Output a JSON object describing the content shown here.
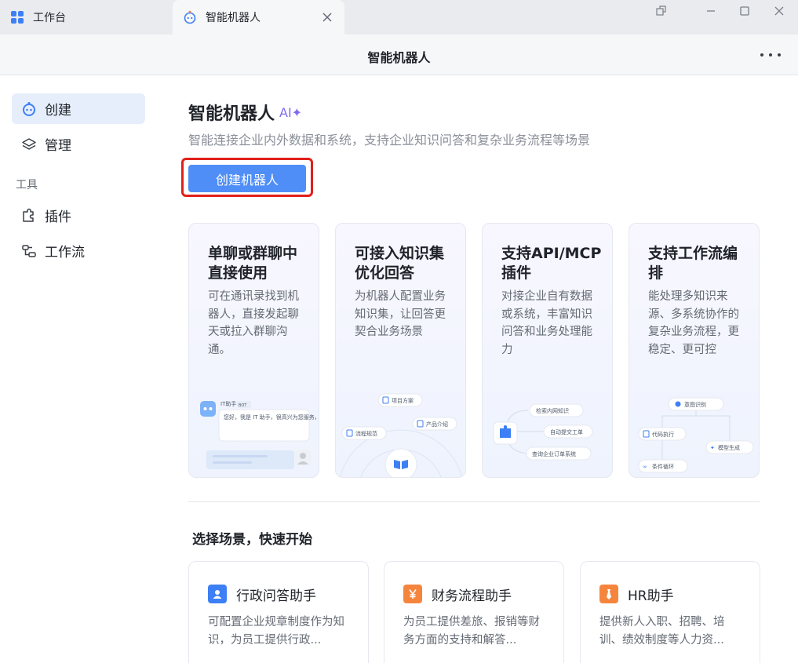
{
  "tabs": [
    {
      "label": "工作台",
      "icon": "grid-icon"
    },
    {
      "label": "智能机器人",
      "icon": "robot-icon"
    }
  ],
  "header": {
    "title": "智能机器人"
  },
  "sidebar": {
    "items": [
      {
        "label": "创建",
        "icon": "robot-icon",
        "active": true
      },
      {
        "label": "管理",
        "icon": "layers-icon"
      }
    ],
    "section_label": "工具",
    "tool_items": [
      {
        "label": "插件",
        "icon": "plugin-icon"
      },
      {
        "label": "工作流",
        "icon": "workflow-icon"
      }
    ]
  },
  "hero": {
    "title": "智能机器人",
    "badge": "AI✦",
    "subtitle": "智能连接企业内外数据和系统，支持企业知识问答和复杂业务流程等场景",
    "create_button": "创建机器人"
  },
  "features": [
    {
      "title": "单聊或群聊中直接使用",
      "desc": "可在通讯录找到机器人，直接发起聊天或拉入群聊沟通。",
      "illu": {
        "bot_name": "IT助手",
        "bot_tag": "BOT",
        "message": "您好，我是 IT 助手，很高兴为您服务，请描述您的问题。"
      }
    },
    {
      "title": "可接入知识集优化回答",
      "desc": "为机器人配置业务知识集，让回答更契合业务场景",
      "illu": {
        "chip1": "项目方案",
        "chip2": "产品介绍",
        "chip3": "流程规范"
      }
    },
    {
      "title": "支持API/MCP插件",
      "desc": "对接企业自有数据或系统，丰富知识问答和业务处理能力",
      "illu": {
        "chip1": "检索内网知识",
        "chip2": "自动提交工单",
        "chip3": "查询企业订单系统"
      }
    },
    {
      "title": "支持工作流编排",
      "desc": "能处理多知识来源、多系统协作的复杂业务流程，更稳定、更可控",
      "illu": {
        "chip1": "意图识别",
        "chip2": "代码执行",
        "chip3": "模型生成",
        "chip4": "条件循环"
      }
    }
  ],
  "scenes_title": "选择场景，快速开始",
  "scenes": [
    {
      "title": "行政问答助手",
      "desc": "可配置企业规章制度作为知识，为员工提供行政...",
      "icon": "person-card-icon",
      "color": "#3d7ff5"
    },
    {
      "title": "财务流程助手",
      "desc": "为员工提供差旅、报销等财务方面的支持和解答...",
      "icon": "yen-icon",
      "color": "#f5853d"
    },
    {
      "title": "HR助手",
      "desc": "提供新人入职、招聘、培训、绩效制度等人力资...",
      "icon": "tie-icon",
      "color": "#f5853d"
    }
  ],
  "colors": {
    "accent": "#4f8ef7",
    "highlight_border": "#e0201a",
    "active_nav_bg": "#e6eefc"
  }
}
